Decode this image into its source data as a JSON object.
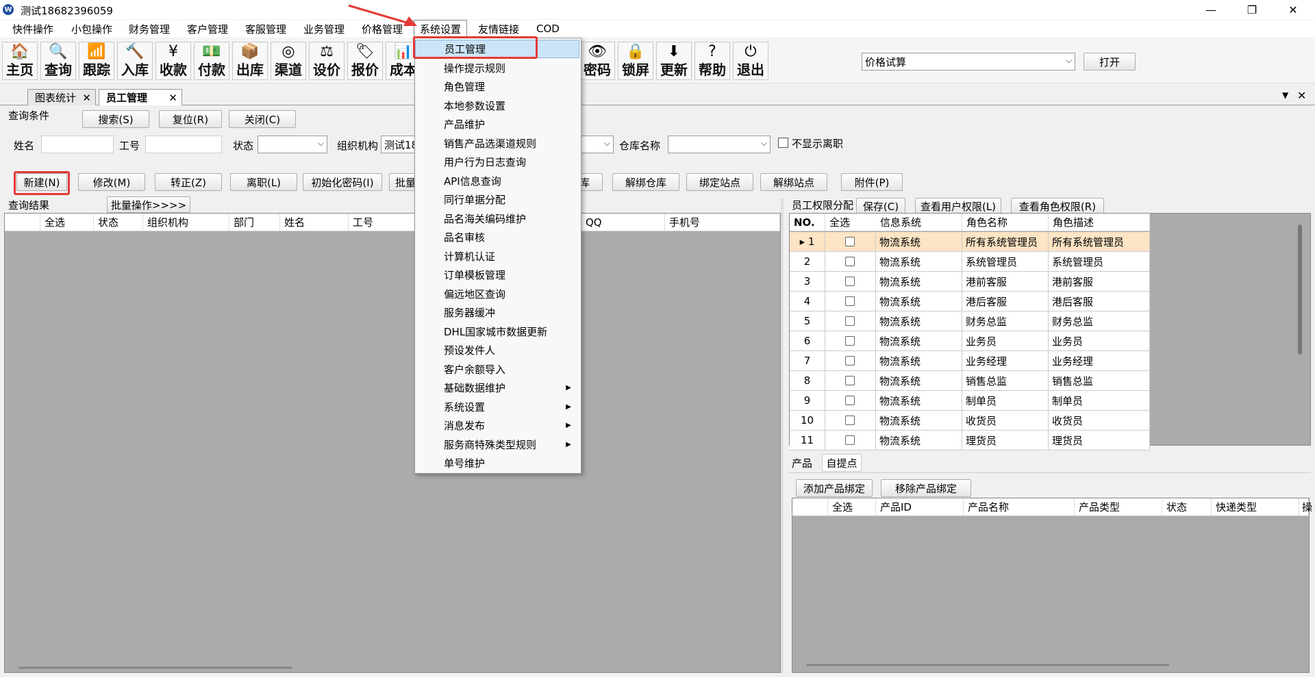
{
  "window": {
    "title": "测试18682396059",
    "logo": "W"
  },
  "menubar": [
    "快件操作",
    "小包操作",
    "财务管理",
    "客户管理",
    "客服管理",
    "业务管理",
    "价格管理",
    "系统设置",
    "友情链接",
    "COD"
  ],
  "toolbar": {
    "left": [
      {
        "label": "主页",
        "icon": "home-icon"
      },
      {
        "label": "查询",
        "icon": "magnifier-icon"
      },
      {
        "label": "跟踪",
        "icon": "signal-icon"
      },
      {
        "label": "入库",
        "icon": "hammer-icon"
      },
      {
        "label": "收款",
        "icon": "yen-icon"
      },
      {
        "label": "付款",
        "icon": "money-icon"
      },
      {
        "label": "出库",
        "icon": "box-icon"
      },
      {
        "label": "渠道",
        "icon": "channel-icon"
      },
      {
        "label": "设价",
        "icon": "scale-icon"
      },
      {
        "label": "报价",
        "icon": "tag-icon"
      },
      {
        "label": "成本",
        "icon": "chart-icon"
      }
    ],
    "right": [
      {
        "label": "密码",
        "icon": "eye-icon"
      },
      {
        "label": "锁屏",
        "icon": "lock-icon"
      },
      {
        "label": "更新",
        "icon": "download-arrow-icon"
      },
      {
        "label": "帮助",
        "icon": "help-icon"
      },
      {
        "label": "退出",
        "icon": "power-icon"
      }
    ],
    "quick_select": "价格试算",
    "open_label": "打开"
  },
  "doc_tabs": [
    {
      "label": "图表统计"
    },
    {
      "label": "员工管理"
    }
  ],
  "query": {
    "section_label": "查询条件",
    "search": "搜索(S)",
    "reset": "复位(R)",
    "close": "关闭(C)",
    "name_label": "姓名",
    "id_label": "工号",
    "status_label": "状态",
    "org_label": "组织机构",
    "org_value": "测试18",
    "warehouse_label": "仓库名称",
    "hide_left_label": "不显示离职"
  },
  "actions": {
    "new": "新建(N)",
    "edit": "修改(M)",
    "regular": "转正(Z)",
    "leave": "离职(L)",
    "init_pwd": "初始化密码(I)",
    "batch": "批量",
    "warehouse_tail": "库",
    "unbind_wh": "解绑仓库",
    "bind_station": "绑定站点",
    "unbind_station": "解绑站点",
    "attachment": "附件(P)"
  },
  "results": {
    "label": "查询结果",
    "batch_op": "批量操作>>>>",
    "columns": [
      "全选",
      "状态",
      "组织机构",
      "部门",
      "姓名",
      "工号",
      "QQ",
      "手机号"
    ]
  },
  "perm": {
    "label": "员工权限分配",
    "save": "保存(C)",
    "view_user": "查看用户权限(L)",
    "view_role": "查看角色权限(R)",
    "columns": [
      "NO.",
      "全选",
      "信息系统",
      "角色名称",
      "角色描述"
    ],
    "rows": [
      {
        "no": "1",
        "system": "物流系统",
        "role": "所有系统管理员",
        "desc": "所有系统管理员"
      },
      {
        "no": "2",
        "system": "物流系统",
        "role": "系统管理员",
        "desc": "系统管理员"
      },
      {
        "no": "3",
        "system": "物流系统",
        "role": "港前客服",
        "desc": "港前客服"
      },
      {
        "no": "4",
        "system": "物流系统",
        "role": "港后客服",
        "desc": "港后客服"
      },
      {
        "no": "5",
        "system": "物流系统",
        "role": "财务总监",
        "desc": "财务总监"
      },
      {
        "no": "6",
        "system": "物流系统",
        "role": "业务员",
        "desc": "业务员"
      },
      {
        "no": "7",
        "system": "物流系统",
        "role": "业务经理",
        "desc": "业务经理"
      },
      {
        "no": "8",
        "system": "物流系统",
        "role": "销售总监",
        "desc": "销售总监"
      },
      {
        "no": "9",
        "system": "物流系统",
        "role": "制单员",
        "desc": "制单员"
      },
      {
        "no": "10",
        "system": "物流系统",
        "role": "收货员",
        "desc": "收货员"
      },
      {
        "no": "11",
        "system": "物流系统",
        "role": "理货员",
        "desc": "理货员"
      }
    ]
  },
  "product": {
    "tabs": [
      "产品",
      "自提点"
    ],
    "add": "添加产品绑定",
    "remove": "移除产品绑定",
    "columns": [
      "全选",
      "产品ID",
      "产品名称",
      "产品类型",
      "状态",
      "快递类型",
      "操"
    ]
  },
  "dropdown": [
    {
      "label": "员工管理"
    },
    {
      "label": "操作提示规则"
    },
    {
      "label": "角色管理"
    },
    {
      "label": "本地参数设置"
    },
    {
      "label": "产品维护"
    },
    {
      "label": "销售产品选渠道规则"
    },
    {
      "label": "用户行为日志查询"
    },
    {
      "label": "API信息查询"
    },
    {
      "label": "同行单据分配"
    },
    {
      "label": "品名海关编码维护"
    },
    {
      "label": "品名审核"
    },
    {
      "label": "计算机认证"
    },
    {
      "label": "订单模板管理"
    },
    {
      "label": "偏远地区查询"
    },
    {
      "label": "服务器缓冲"
    },
    {
      "label": "DHL国家城市数据更新"
    },
    {
      "label": "预设发件人"
    },
    {
      "label": "客户余额导入"
    },
    {
      "label": "基础数据维护",
      "sub": true
    },
    {
      "label": "系统设置",
      "sub": true
    },
    {
      "label": "消息发布",
      "sub": true
    },
    {
      "label": "服务商特殊类型规则",
      "sub": true
    },
    {
      "label": "单号维护"
    }
  ],
  "colors": {
    "annotation": "#e53935",
    "selected_row": "#fce4c4",
    "grid_bg": "#ababab"
  }
}
